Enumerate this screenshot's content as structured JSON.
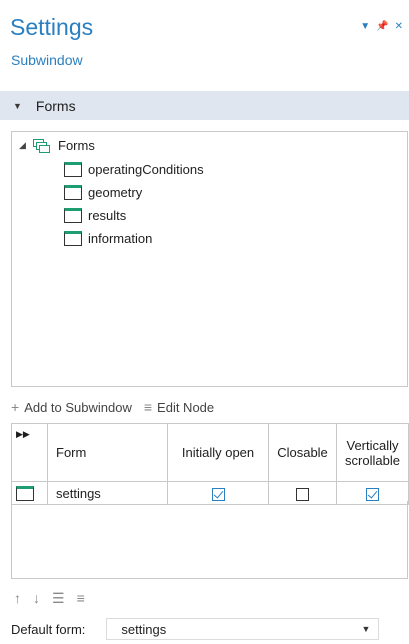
{
  "header": {
    "title": "Settings",
    "subtitle": "Subwindow"
  },
  "section": {
    "label": "Forms"
  },
  "tree": {
    "root": "Forms",
    "items": [
      "operatingConditions",
      "geometry",
      "results",
      "information"
    ]
  },
  "toolbar": {
    "add_label": "Add to Subwindow",
    "edit_label": "Edit Node"
  },
  "table": {
    "columns": [
      "Form",
      "Initially open",
      "Closable",
      "Vertically scrollable"
    ],
    "rows": [
      {
        "form": "settings",
        "initially_open": true,
        "closable": false,
        "vertically_scrollable": true
      }
    ]
  },
  "default_form": {
    "label": "Default form:",
    "value": "settings"
  },
  "colors": {
    "accent": "#2a7fc1",
    "form_icon": "#1e9e70",
    "section_bg": "#dfe6ef"
  }
}
